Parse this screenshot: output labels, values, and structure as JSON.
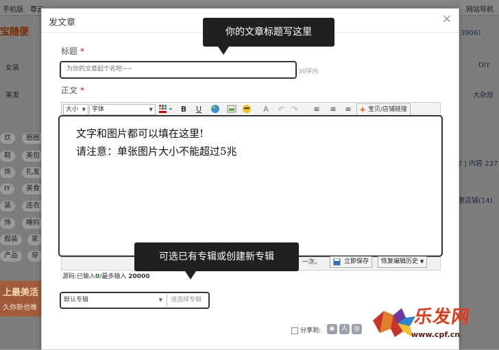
{
  "background": {
    "topbar": [
      "手机版",
      "尊云",
      "网站导航"
    ],
    "logo": "宝随便",
    "menu": [
      "女装",
      "美发"
    ],
    "right_menu": [
      "DIY",
      "大杂烩"
    ],
    "tags": [
      "炊",
      "圈圈",
      "鞋",
      "美包",
      "饰",
      "扎发",
      "IY",
      "美食",
      "装",
      "连衣",
      "饰",
      "睡妈",
      "假装",
      "家",
      "产品",
      "穿"
    ],
    "right_info": [
      "3906)",
      "7 | 内容 2373",
      "惠店铺(14)"
    ],
    "banner_title": "上最美活",
    "banner_sub": "久你新也难"
  },
  "dialog": {
    "title": "发文章",
    "close": "×",
    "title_label": "标题",
    "required_mark": "*",
    "title_placeholder": "为你的文章起个名吧~~",
    "title_limit": "30字内",
    "body_label": "正文",
    "toolbar": {
      "size": "大小",
      "font": "字体",
      "bold": "B",
      "underline": "U",
      "link_button": "宝贝/店铺链接"
    },
    "editor_text": {
      "line1": "文字和图片都可以填在这里!",
      "line2": "请注意：单张图片大小不能超过5兆"
    },
    "footer": {
      "autosave_suffix": "一次。",
      "save_now": "立即保存",
      "restore_history": "恢复编辑历史"
    },
    "count": {
      "prefix": "源码:已输入",
      "current": "0",
      "middle": "/最多输入",
      "max": "20000"
    },
    "album": {
      "default": "默认专辑",
      "placeholder": "请选择专辑"
    },
    "share_label": "分享到:"
  },
  "callouts": {
    "title_tip": "你的文章标题写这里",
    "album_tip": "可选已有专辑或创建新专辑"
  },
  "watermark": {
    "brand": "乐发网",
    "url": "www.cpf.cn"
  },
  "colors": {
    "overlay": "#7d7d7d",
    "callout_bg": "#202020",
    "required": "#dd0000",
    "count_green": "#1a7a1a",
    "watermark_red": "#e03a18"
  }
}
